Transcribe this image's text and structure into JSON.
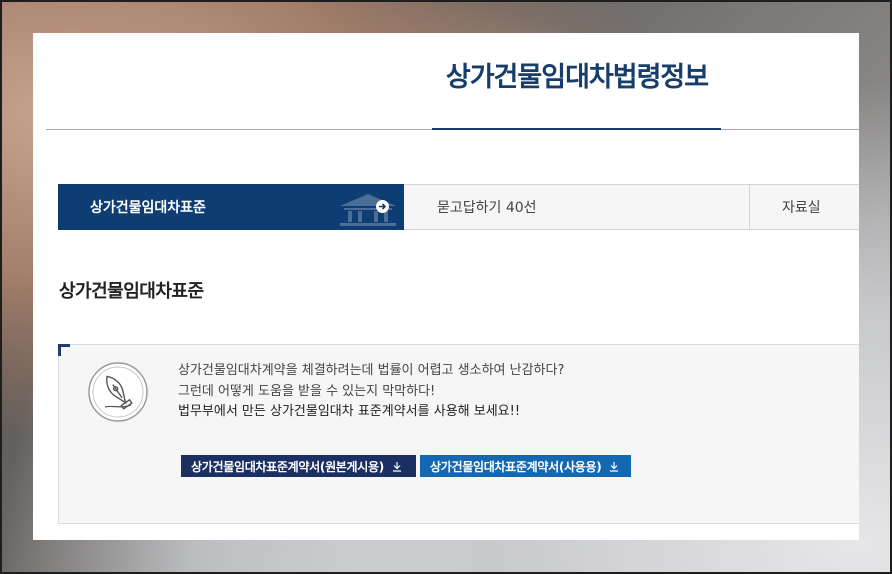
{
  "page": {
    "title": "상가건물임대차법령정보"
  },
  "tabs": [
    {
      "label": "상가건물임대차표준",
      "active": true
    },
    {
      "label": "묻고답하기 40선",
      "active": false
    },
    {
      "label": "자료실",
      "active": false
    }
  ],
  "section": {
    "title": "상가건물임대차표준"
  },
  "info": {
    "line1": "상가건물임대차계약을 체결하려는데 법률이 어렵고 생소하여 난감하다?",
    "line2": "그런데 어떻게 도움을 받을 수 있는지 막막하다!",
    "line3": "법무부에서 만든 상가건물임대차 표준계약서를 사용해 보세요!!"
  },
  "buttons": {
    "original_label": "상가건물임대차표준계약서(원본게시용)",
    "use_label": "상가건물임대차표준계약서(사용용)"
  },
  "colors": {
    "primary": "#0e3d73",
    "button_dark": "#1b2f62",
    "button_blue": "#1468b2"
  },
  "icons": [
    "building-icon",
    "arrow-right-icon",
    "fountain-pen-icon",
    "download-icon"
  ]
}
